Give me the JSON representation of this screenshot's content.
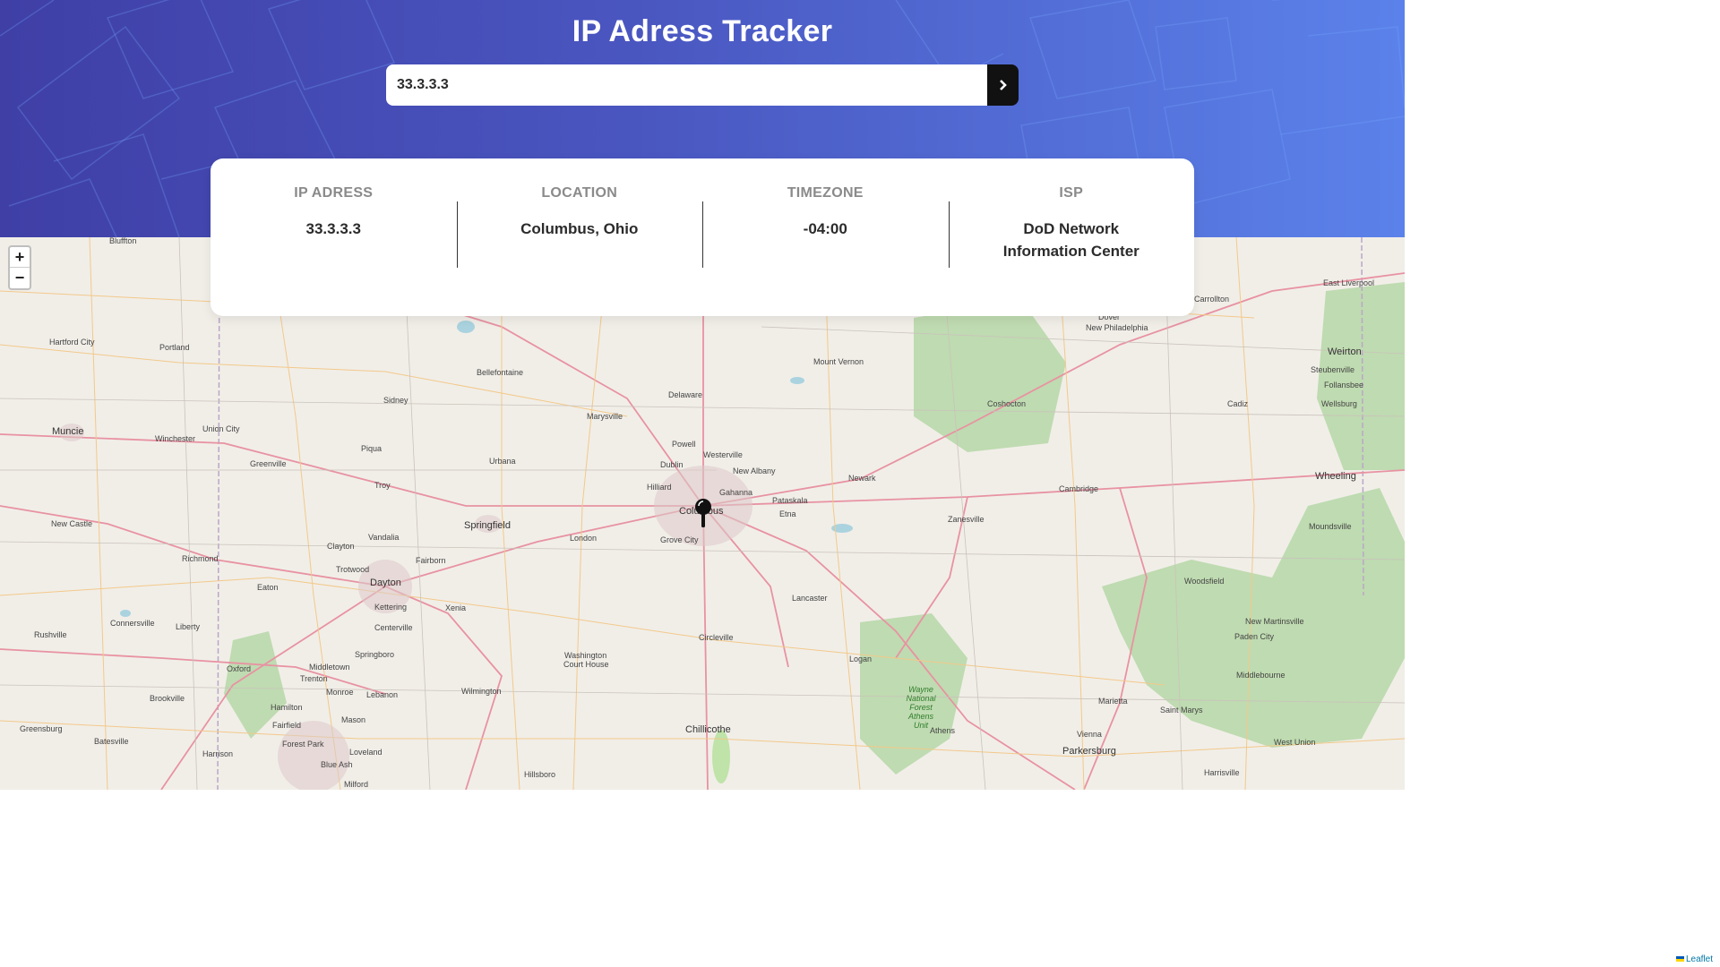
{
  "header": {
    "title": "IP Adress Tracker"
  },
  "search": {
    "value": "33.3.3.3",
    "button_icon": "chevron-right-icon"
  },
  "info": [
    {
      "label": "IP ADRESS",
      "value": "33.3.3.3"
    },
    {
      "label": "LOCATION",
      "value": "Columbus, Ohio"
    },
    {
      "label": "TIMEZONE",
      "value": "-04:00"
    },
    {
      "label": "ISP",
      "value": "DoD Network Information Center"
    }
  ],
  "map": {
    "zoom_in": "+",
    "zoom_out": "−",
    "attribution": "Leaflet",
    "cities": [
      "Bluffton",
      "Hartford City",
      "Portland",
      "Muncie",
      "Winchester",
      "Union City",
      "Sidney",
      "Bellefontaine",
      "Delaware",
      "Marysville",
      "Mount Vernon",
      "Coshocton",
      "Dover",
      "New Philadelphia",
      "Carrollton",
      "East Liverpool",
      "Weirton",
      "Steubenville",
      "Follansbee",
      "Wellsburg",
      "Cadiz",
      "Powell",
      "Westerville",
      "Dublin",
      "New Albany",
      "Hilliard",
      "Gahanna",
      "Pataskala",
      "Newark",
      "Etna",
      "Columbus",
      "Grove City",
      "London",
      "Springfield",
      "Urbana",
      "Piqua",
      "Greenville",
      "Troy",
      "Vandalia",
      "Fairborn",
      "Clayton",
      "Trotwood",
      "Richmond",
      "New Castle",
      "Dayton",
      "Kettering",
      "Eaton",
      "Xenia",
      "Centerville",
      "Springboro",
      "Washington Court House",
      "Circleville",
      "Lancaster",
      "Zanesville",
      "Cambridge",
      "Wheeling",
      "Moundsville",
      "Woodsfield",
      "New Martinsville",
      "Paden City",
      "Middlebourne",
      "Marietta",
      "Saint Marys",
      "Parkersburg",
      "Vienna",
      "Harrisville",
      "West Union",
      "Logan",
      "Athens",
      "Chillicothe",
      "Hillsboro",
      "Wilmington",
      "Lebanon",
      "Mason",
      "Monroe",
      "Middletown",
      "Trenton",
      "Oxford",
      "Hamilton",
      "Fairfield",
      "Forest Park",
      "Loveland",
      "Blue Ash",
      "Milford",
      "Harrison",
      "Batesville",
      "Greensburg",
      "Brookville",
      "Connersville",
      "Liberty",
      "Rushville",
      "Wayne National Forest Athens Unit"
    ]
  }
}
